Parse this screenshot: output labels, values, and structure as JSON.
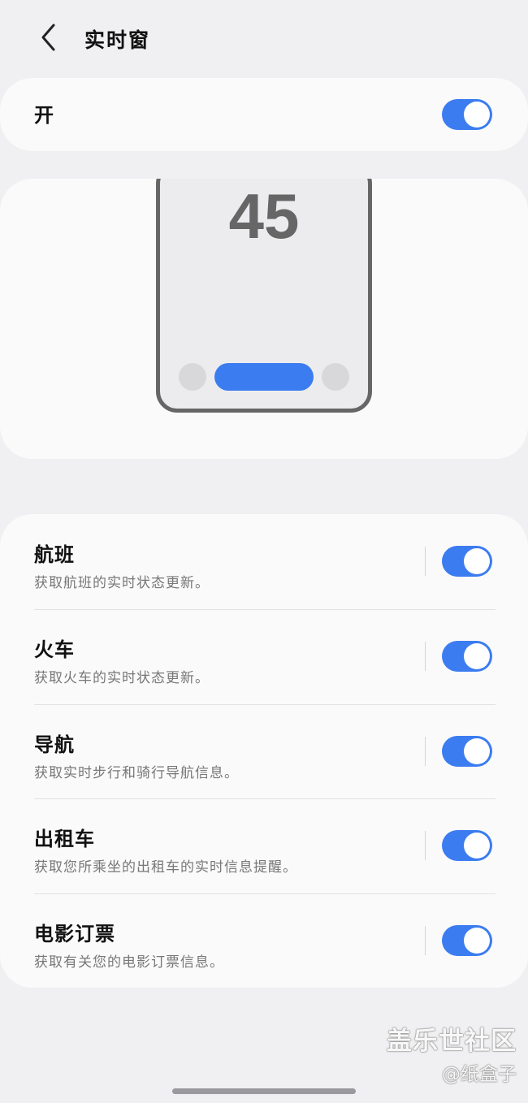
{
  "header": {
    "back_icon": "chevron-left-icon",
    "title": "实时窗"
  },
  "master": {
    "label": "开",
    "enabled": true
  },
  "preview": {
    "number": "45"
  },
  "items": [
    {
      "title": "航班",
      "description": "获取航班的实时状态更新。",
      "enabled": true
    },
    {
      "title": "火车",
      "description": "获取火车的实时状态更新。",
      "enabled": true
    },
    {
      "title": "导航",
      "description": "获取实时步行和骑行导航信息。",
      "enabled": true
    },
    {
      "title": "出租车",
      "description": "获取您所乘坐的出租车的实时信息提醒。",
      "enabled": true
    },
    {
      "title": "电影订票",
      "description": "获取有关您的电影订票信息。",
      "enabled": true
    }
  ],
  "watermark": {
    "main": "盖乐世社区",
    "sub": "@纸盒子"
  },
  "colors": {
    "accent": "#3b7cf0",
    "background": "#f0f0f2",
    "card": "#fafafb"
  }
}
